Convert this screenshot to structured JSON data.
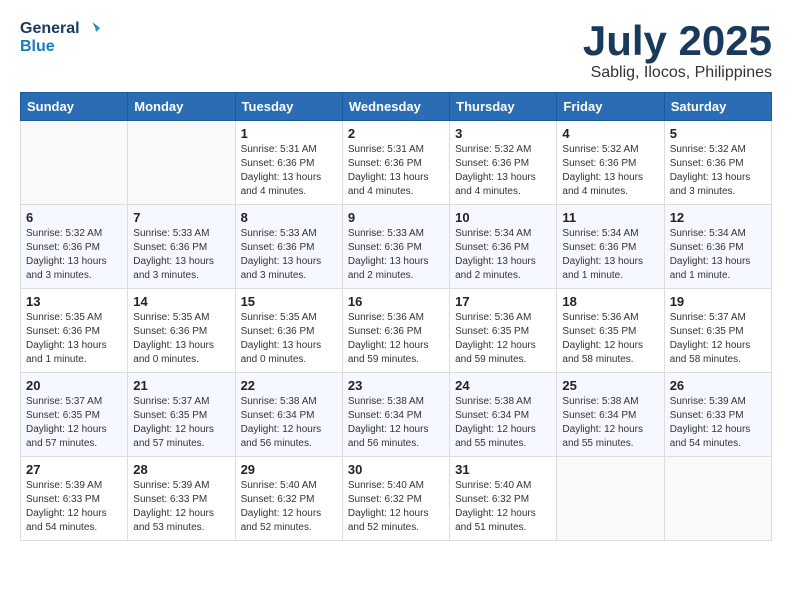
{
  "header": {
    "logo_general": "General",
    "logo_blue": "Blue",
    "month_title": "July 2025",
    "subtitle": "Sablig, Ilocos, Philippines"
  },
  "days_of_week": [
    "Sunday",
    "Monday",
    "Tuesday",
    "Wednesday",
    "Thursday",
    "Friday",
    "Saturday"
  ],
  "weeks": [
    [
      {
        "day": "",
        "content": ""
      },
      {
        "day": "",
        "content": ""
      },
      {
        "day": "1",
        "content": "Sunrise: 5:31 AM\nSunset: 6:36 PM\nDaylight: 13 hours and 4 minutes."
      },
      {
        "day": "2",
        "content": "Sunrise: 5:31 AM\nSunset: 6:36 PM\nDaylight: 13 hours and 4 minutes."
      },
      {
        "day": "3",
        "content": "Sunrise: 5:32 AM\nSunset: 6:36 PM\nDaylight: 13 hours and 4 minutes."
      },
      {
        "day": "4",
        "content": "Sunrise: 5:32 AM\nSunset: 6:36 PM\nDaylight: 13 hours and 4 minutes."
      },
      {
        "day": "5",
        "content": "Sunrise: 5:32 AM\nSunset: 6:36 PM\nDaylight: 13 hours and 3 minutes."
      }
    ],
    [
      {
        "day": "6",
        "content": "Sunrise: 5:32 AM\nSunset: 6:36 PM\nDaylight: 13 hours and 3 minutes."
      },
      {
        "day": "7",
        "content": "Sunrise: 5:33 AM\nSunset: 6:36 PM\nDaylight: 13 hours and 3 minutes."
      },
      {
        "day": "8",
        "content": "Sunrise: 5:33 AM\nSunset: 6:36 PM\nDaylight: 13 hours and 3 minutes."
      },
      {
        "day": "9",
        "content": "Sunrise: 5:33 AM\nSunset: 6:36 PM\nDaylight: 13 hours and 2 minutes."
      },
      {
        "day": "10",
        "content": "Sunrise: 5:34 AM\nSunset: 6:36 PM\nDaylight: 13 hours and 2 minutes."
      },
      {
        "day": "11",
        "content": "Sunrise: 5:34 AM\nSunset: 6:36 PM\nDaylight: 13 hours and 1 minute."
      },
      {
        "day": "12",
        "content": "Sunrise: 5:34 AM\nSunset: 6:36 PM\nDaylight: 13 hours and 1 minute."
      }
    ],
    [
      {
        "day": "13",
        "content": "Sunrise: 5:35 AM\nSunset: 6:36 PM\nDaylight: 13 hours and 1 minute."
      },
      {
        "day": "14",
        "content": "Sunrise: 5:35 AM\nSunset: 6:36 PM\nDaylight: 13 hours and 0 minutes."
      },
      {
        "day": "15",
        "content": "Sunrise: 5:35 AM\nSunset: 6:36 PM\nDaylight: 13 hours and 0 minutes."
      },
      {
        "day": "16",
        "content": "Sunrise: 5:36 AM\nSunset: 6:36 PM\nDaylight: 12 hours and 59 minutes."
      },
      {
        "day": "17",
        "content": "Sunrise: 5:36 AM\nSunset: 6:35 PM\nDaylight: 12 hours and 59 minutes."
      },
      {
        "day": "18",
        "content": "Sunrise: 5:36 AM\nSunset: 6:35 PM\nDaylight: 12 hours and 58 minutes."
      },
      {
        "day": "19",
        "content": "Sunrise: 5:37 AM\nSunset: 6:35 PM\nDaylight: 12 hours and 58 minutes."
      }
    ],
    [
      {
        "day": "20",
        "content": "Sunrise: 5:37 AM\nSunset: 6:35 PM\nDaylight: 12 hours and 57 minutes."
      },
      {
        "day": "21",
        "content": "Sunrise: 5:37 AM\nSunset: 6:35 PM\nDaylight: 12 hours and 57 minutes."
      },
      {
        "day": "22",
        "content": "Sunrise: 5:38 AM\nSunset: 6:34 PM\nDaylight: 12 hours and 56 minutes."
      },
      {
        "day": "23",
        "content": "Sunrise: 5:38 AM\nSunset: 6:34 PM\nDaylight: 12 hours and 56 minutes."
      },
      {
        "day": "24",
        "content": "Sunrise: 5:38 AM\nSunset: 6:34 PM\nDaylight: 12 hours and 55 minutes."
      },
      {
        "day": "25",
        "content": "Sunrise: 5:38 AM\nSunset: 6:34 PM\nDaylight: 12 hours and 55 minutes."
      },
      {
        "day": "26",
        "content": "Sunrise: 5:39 AM\nSunset: 6:33 PM\nDaylight: 12 hours and 54 minutes."
      }
    ],
    [
      {
        "day": "27",
        "content": "Sunrise: 5:39 AM\nSunset: 6:33 PM\nDaylight: 12 hours and 54 minutes."
      },
      {
        "day": "28",
        "content": "Sunrise: 5:39 AM\nSunset: 6:33 PM\nDaylight: 12 hours and 53 minutes."
      },
      {
        "day": "29",
        "content": "Sunrise: 5:40 AM\nSunset: 6:32 PM\nDaylight: 12 hours and 52 minutes."
      },
      {
        "day": "30",
        "content": "Sunrise: 5:40 AM\nSunset: 6:32 PM\nDaylight: 12 hours and 52 minutes."
      },
      {
        "day": "31",
        "content": "Sunrise: 5:40 AM\nSunset: 6:32 PM\nDaylight: 12 hours and 51 minutes."
      },
      {
        "day": "",
        "content": ""
      },
      {
        "day": "",
        "content": ""
      }
    ]
  ]
}
